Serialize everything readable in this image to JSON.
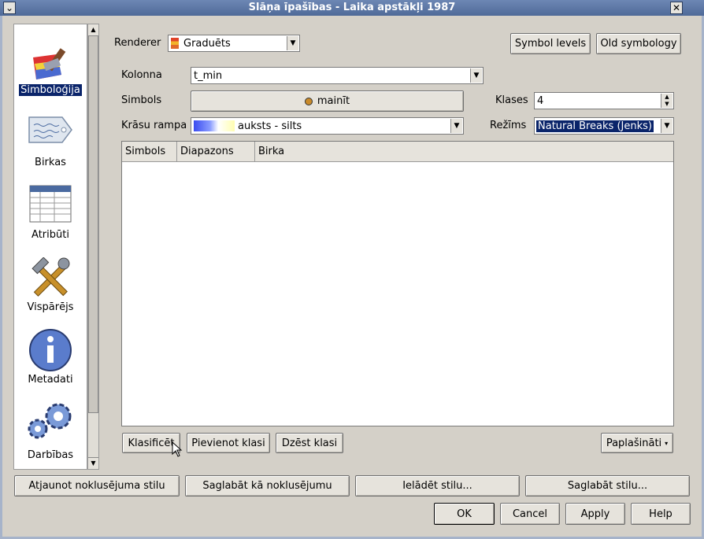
{
  "window": {
    "title": "Slāņa īpašības - Laika apstākļi 1987"
  },
  "sidebar": {
    "items": [
      {
        "label": "Simboloģija"
      },
      {
        "label": "Birkas"
      },
      {
        "label": "Atribūti"
      },
      {
        "label": "Vispārējs"
      },
      {
        "label": "Metadati"
      },
      {
        "label": "Darbības"
      }
    ]
  },
  "renderer": {
    "label": "Renderer",
    "value": "Graduēts"
  },
  "buttons_top": {
    "symbol_levels": "Symbol levels",
    "old_symbology": "Old symbology"
  },
  "form": {
    "column_label": "Kolonna",
    "column_value": "t_min",
    "symbol_label": "Simbols",
    "symbol_button": "mainīt",
    "classes_label": "Klases",
    "classes_value": "4",
    "ramp_label": "Krāsu rampa",
    "ramp_value": "auksts - silts",
    "mode_label": "Režīms",
    "mode_value": "Natural Breaks (Jenks)"
  },
  "table": {
    "columns": [
      "Simbols",
      "Diapazons",
      "Birka"
    ]
  },
  "class_buttons": {
    "classify": "Klasificēt",
    "add": "Pievienot klasi",
    "delete": "Dzēst klasi",
    "advanced": "Paplašināti"
  },
  "style_buttons": {
    "restore": "Atjaunot noklusējuma stilu",
    "save_default": "Saglabāt kā noklusējumu",
    "load": "Ielādēt stilu...",
    "save": "Saglabāt stilu..."
  },
  "dialog_buttons": {
    "ok": "OK",
    "cancel": "Cancel",
    "apply": "Apply",
    "help": "Help"
  },
  "colors": {
    "accent": "#0a246a",
    "titlebar": "#5a75a5"
  }
}
